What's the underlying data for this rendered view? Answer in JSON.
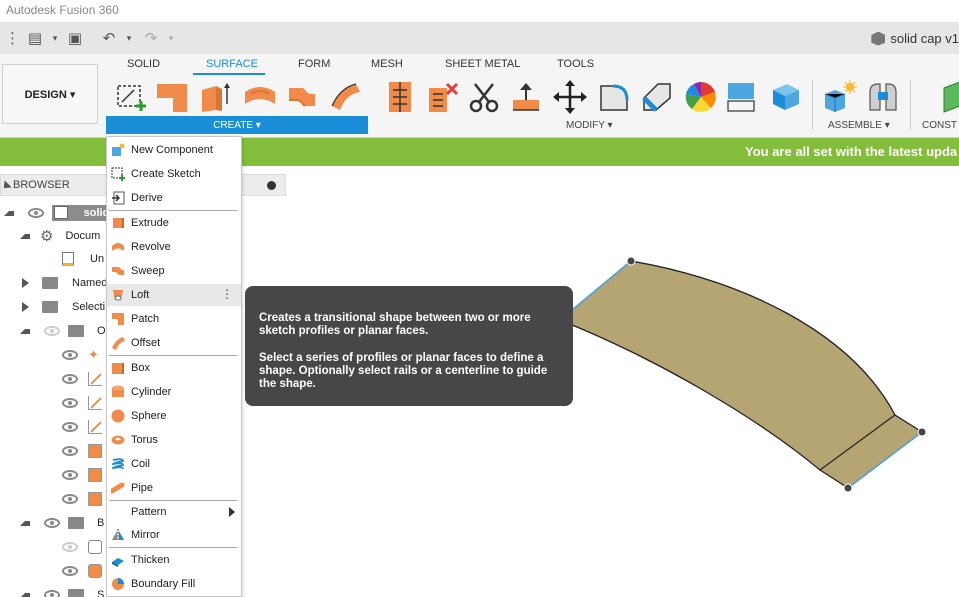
{
  "app": {
    "title": "Autodesk Fusion 360"
  },
  "document": {
    "name": "solid cap v1"
  },
  "workspace": {
    "label": "DESIGN ▾"
  },
  "tabs": [
    "SOLID",
    "SURFACE",
    "FORM",
    "MESH",
    "SHEET METAL",
    "TOOLS"
  ],
  "groups": {
    "create": "CREATE ▾",
    "modify": "MODIFY ▾",
    "assemble": "ASSEMBLE ▾",
    "construct": "CONST"
  },
  "banner": {
    "text": "You are all set with the latest upda"
  },
  "browser": {
    "header": "BROWSER",
    "root": "solid",
    "items": [
      "Docum",
      "Un",
      "Named",
      "Selecti",
      "O",
      "B",
      "S"
    ]
  },
  "menu": {
    "items": [
      "New Component",
      "Create Sketch",
      "Derive",
      "Extrude",
      "Revolve",
      "Sweep",
      "Loft",
      "Patch",
      "Offset",
      "Box",
      "Cylinder",
      "Sphere",
      "Torus",
      "Coil",
      "Pipe",
      "Pattern",
      "Mirror",
      "Thicken",
      "Boundary Fill"
    ],
    "hovered": "Loft"
  },
  "tooltip": {
    "line1": "Creates a transitional shape between two or more sketch profiles or planar faces.",
    "line2": "Select a series of profiles or planar faces to define a shape. Optionally select rails or a centerline to guide the shape."
  },
  "colors": {
    "accent": "#1a8ed8",
    "banner": "#82bd3b",
    "surface": "#b4a572",
    "tool_orange": "#f08b4a"
  }
}
